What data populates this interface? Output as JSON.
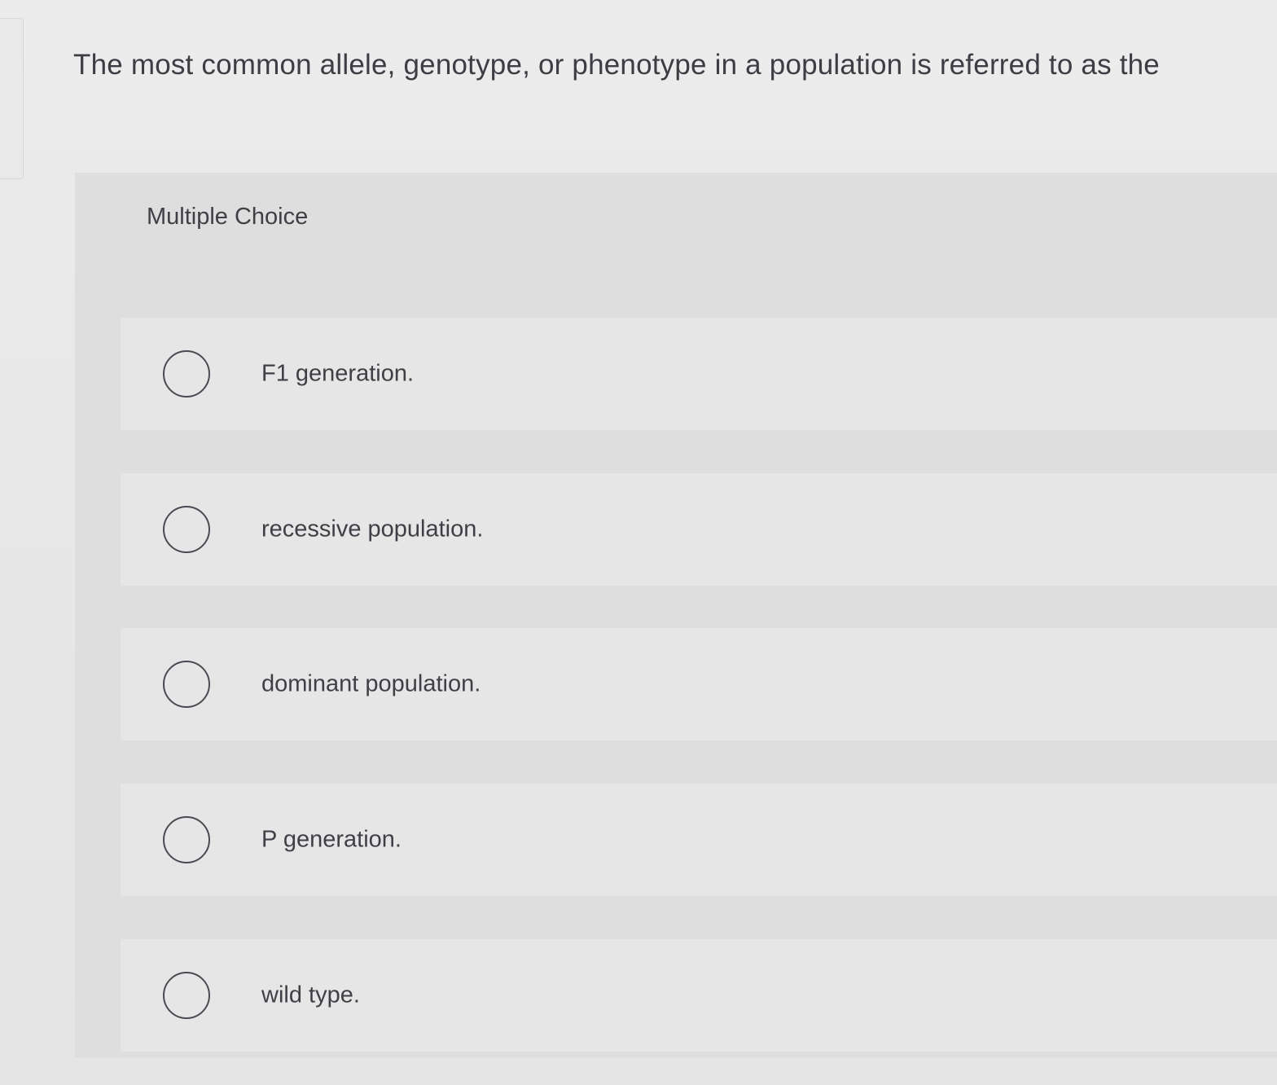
{
  "question": {
    "text": "The most common allele, genotype, or phenotype in a population is referred to as the"
  },
  "choices": {
    "heading": "Multiple Choice",
    "options": [
      {
        "label": "F1 generation."
      },
      {
        "label": "recessive population."
      },
      {
        "label": "dominant population."
      },
      {
        "label": "P generation."
      },
      {
        "label": "wild type."
      }
    ]
  }
}
